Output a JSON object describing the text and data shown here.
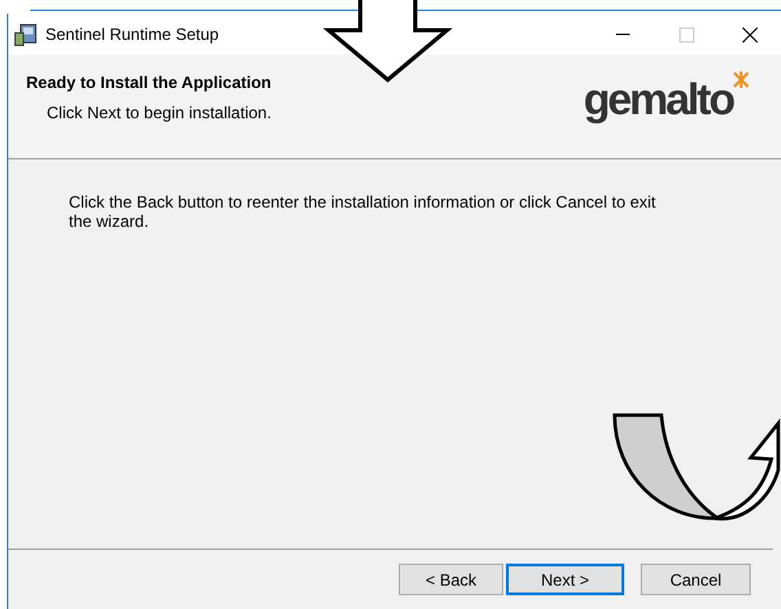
{
  "window": {
    "title": "Sentinel Runtime Setup",
    "controls": [
      {
        "kind": "minimize",
        "disabled": false
      },
      {
        "kind": "maximize",
        "disabled": true
      },
      {
        "kind": "close",
        "disabled": false
      }
    ]
  },
  "header": {
    "title": "Ready to Install the Application",
    "subtitle": "Click Next to begin installation.",
    "logo": "gemalto"
  },
  "body": {
    "text": "Click the Back button to reenter the installation information or click Cancel to exit the wizard."
  },
  "buttons": [
    {
      "label": "< Back",
      "default": false
    },
    {
      "label": "Next >",
      "default": true
    },
    {
      "label": "Cancel",
      "default": false
    }
  ]
}
